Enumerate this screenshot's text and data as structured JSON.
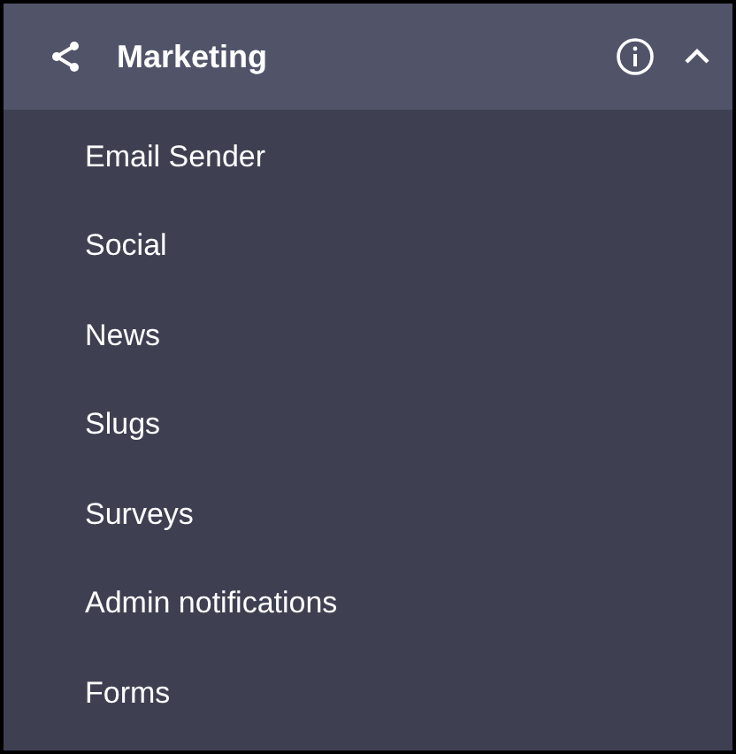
{
  "section": {
    "title": "Marketing",
    "expanded": true
  },
  "items": [
    {
      "label": "Email Sender"
    },
    {
      "label": "Social"
    },
    {
      "label": "News"
    },
    {
      "label": "Slugs"
    },
    {
      "label": "Surveys"
    },
    {
      "label": "Admin notifications"
    },
    {
      "label": "Forms"
    }
  ]
}
